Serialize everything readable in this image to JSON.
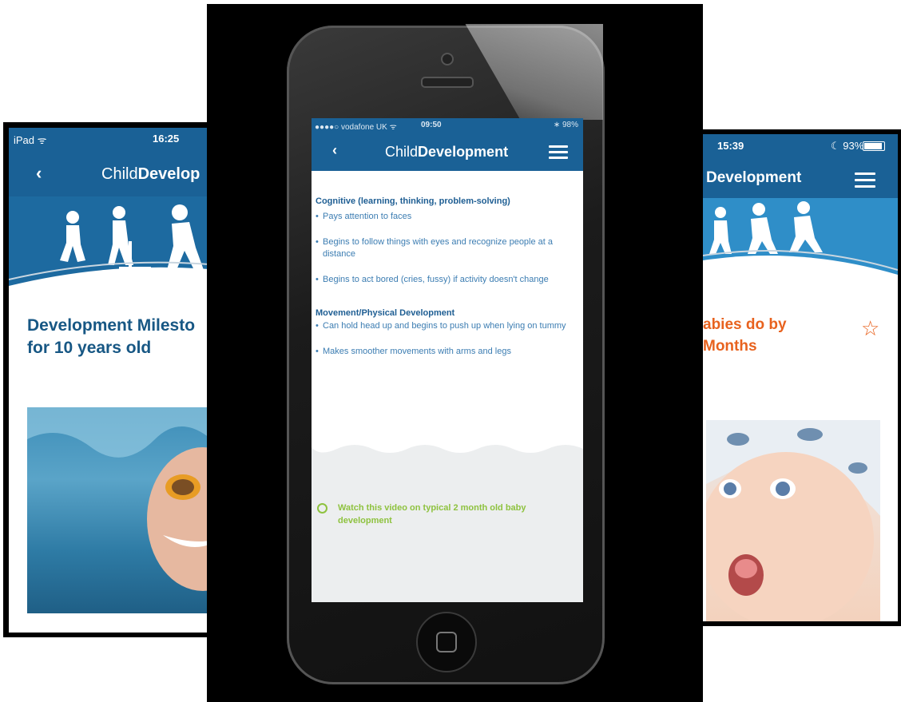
{
  "left_screen": {
    "status": {
      "carrier": "iPad ᯤ",
      "time": "16:25"
    },
    "nav": {
      "back": "‹",
      "title_prefix": "Child",
      "title_bold": "Develop"
    },
    "heading": "Development Milesto\nfor 10 years old"
  },
  "center_screen": {
    "status": {
      "carrier": "●●●●○ vodafone UK ᯤ",
      "time": "09:50",
      "battery": "∗ 98%"
    },
    "nav": {
      "back": "‹",
      "title_prefix": "Child",
      "title_bold": "Development"
    },
    "sections": [
      {
        "heading": "Cognitive (learning, thinking, problem-solving)",
        "bullets": [
          "Pays attention to faces",
          "Begins to follow things with eyes and recognize people at a distance",
          "Begins to act bored (cries, fussy) if activity doesn't change"
        ]
      },
      {
        "heading": "Movement/Physical Development",
        "bullets": [
          "Can hold head up and begins to push up when lying on tummy",
          "Makes smoother movements with arms and legs"
        ]
      }
    ],
    "video_link": "Watch this video on typical 2 month old baby development"
  },
  "right_screen": {
    "status": {
      "time": "15:39",
      "battery": "☾ 93%"
    },
    "nav": {
      "title": "Development"
    },
    "heading": "abies do by\nMonths",
    "star": "☆"
  },
  "colors": {
    "brand_blue": "#1a6196",
    "heading_orange": "#e8621e",
    "link_green": "#8ec23f"
  }
}
